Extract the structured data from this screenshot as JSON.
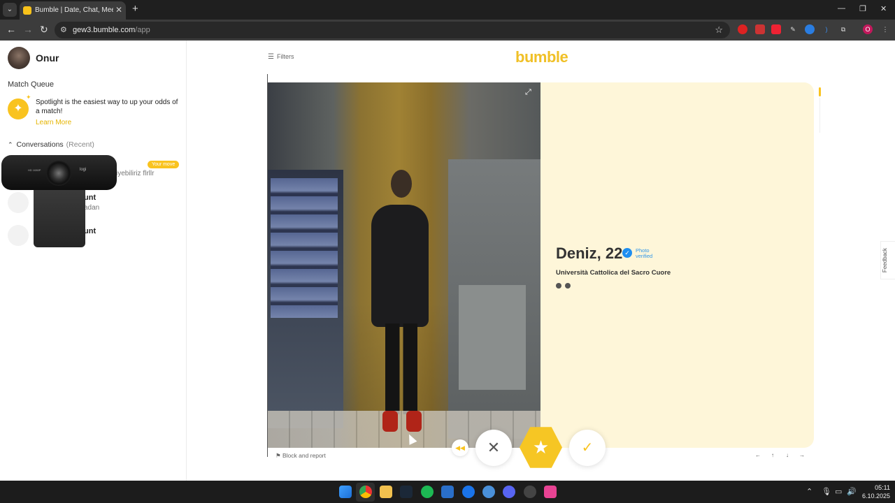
{
  "browser": {
    "tab_title": "Bumble | Date, Chat, Meet New",
    "url_host": "gew3.bumble.com",
    "url_path": "/app",
    "profile_initial": "O"
  },
  "sidebar": {
    "user_name": "Onur",
    "match_queue_title": "Match Queue",
    "spotlight_text": "Spotlight is the easiest way to up your odds of a match!",
    "learn_more": "Learn More",
    "conversations_title": "Conversations",
    "conversations_filter": "(Recent)",
    "conversations": [
      {
        "badge": "Your move",
        "preview": "iyebiliriz flrllr"
      },
      {
        "name": "unt",
        "preview": "adan"
      },
      {
        "name": "unt"
      }
    ],
    "webcam_brand": "logi"
  },
  "main": {
    "filters_label": "Filters",
    "logo_text": "bumble",
    "profile": {
      "name_age": "Deniz, 22",
      "verified_label": "Photo verified",
      "school": "Università Cattolica del Sacro Cuore"
    },
    "block_report": "Block and report",
    "feedback": "Feedback",
    "keyboard_hints": [
      "←",
      "↑",
      "↓",
      "→"
    ]
  },
  "taskbar": {
    "time": "05:11",
    "date": "6.10.2025"
  },
  "colors": {
    "brand_yellow": "#f9c31f",
    "info_panel_bg": "#fef6d9",
    "verified_blue": "#1e8ef0"
  }
}
